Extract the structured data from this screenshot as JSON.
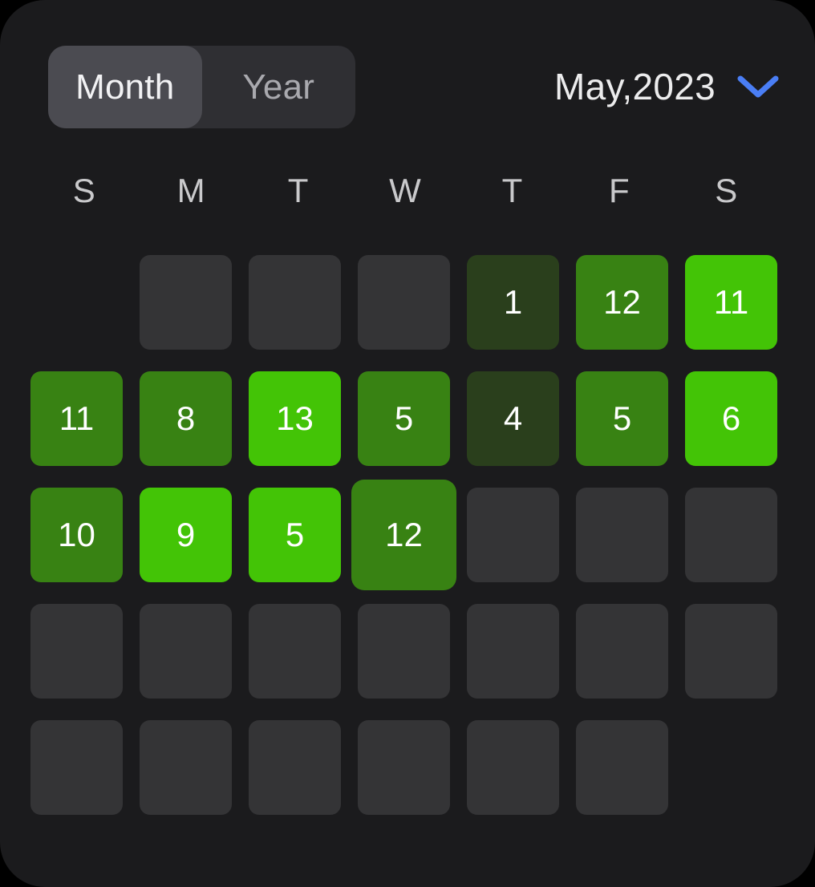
{
  "card": {
    "background_color": "#1b1b1d",
    "page_background_color": "#000000"
  },
  "header": {
    "segmented_control": {
      "name": "view-mode",
      "selected": "Month",
      "options": [
        {
          "label": "Month",
          "selected": true
        },
        {
          "label": "Year",
          "selected": false
        }
      ]
    },
    "month_selector": {
      "label": "May,2023",
      "month": "May",
      "year": "2023",
      "chevron_icon": "chevron-down-icon",
      "chevron_color": "#4a7ef5"
    }
  },
  "weekdays": [
    "S",
    "M",
    "T",
    "W",
    "T",
    "F",
    "S"
  ],
  "legend_colors": {
    "empty": "#343436",
    "level_1_low": "#2a3f1c",
    "level_2_mid": "#388213",
    "level_3_high": "#43c406",
    "day_text": "#ffffff"
  },
  "grid": {
    "columns": 7,
    "rows": 5,
    "cells": [
      {
        "value": "",
        "state": "blank",
        "level": 0,
        "selected": false
      },
      {
        "value": "",
        "state": "empty",
        "level": 0,
        "selected": false
      },
      {
        "value": "",
        "state": "empty",
        "level": 0,
        "selected": false
      },
      {
        "value": "",
        "state": "empty",
        "level": 0,
        "selected": false
      },
      {
        "value": "1",
        "state": "filled",
        "level": 1,
        "selected": false
      },
      {
        "value": "12",
        "state": "filled",
        "level": 2,
        "selected": false
      },
      {
        "value": "11",
        "state": "filled",
        "level": 3,
        "selected": false
      },
      {
        "value": "11",
        "state": "filled",
        "level": 2,
        "selected": false
      },
      {
        "value": "8",
        "state": "filled",
        "level": 2,
        "selected": false
      },
      {
        "value": "13",
        "state": "filled",
        "level": 3,
        "selected": false
      },
      {
        "value": "5",
        "state": "filled",
        "level": 2,
        "selected": false
      },
      {
        "value": "4",
        "state": "filled",
        "level": 1,
        "selected": false
      },
      {
        "value": "5",
        "state": "filled",
        "level": 2,
        "selected": false
      },
      {
        "value": "6",
        "state": "filled",
        "level": 3,
        "selected": false
      },
      {
        "value": "10",
        "state": "filled",
        "level": 2,
        "selected": false
      },
      {
        "value": "9",
        "state": "filled",
        "level": 3,
        "selected": false
      },
      {
        "value": "5",
        "state": "filled",
        "level": 3,
        "selected": false
      },
      {
        "value": "12",
        "state": "filled",
        "level": 2,
        "selected": true
      },
      {
        "value": "",
        "state": "empty",
        "level": 0,
        "selected": false
      },
      {
        "value": "",
        "state": "empty",
        "level": 0,
        "selected": false
      },
      {
        "value": "",
        "state": "empty",
        "level": 0,
        "selected": false
      },
      {
        "value": "",
        "state": "empty",
        "level": 0,
        "selected": false
      },
      {
        "value": "",
        "state": "empty",
        "level": 0,
        "selected": false
      },
      {
        "value": "",
        "state": "empty",
        "level": 0,
        "selected": false
      },
      {
        "value": "",
        "state": "empty",
        "level": 0,
        "selected": false
      },
      {
        "value": "",
        "state": "empty",
        "level": 0,
        "selected": false
      },
      {
        "value": "",
        "state": "empty",
        "level": 0,
        "selected": false
      },
      {
        "value": "",
        "state": "empty",
        "level": 0,
        "selected": false
      },
      {
        "value": "",
        "state": "empty",
        "level": 0,
        "selected": false
      },
      {
        "value": "",
        "state": "empty",
        "level": 0,
        "selected": false
      },
      {
        "value": "",
        "state": "empty",
        "level": 0,
        "selected": false
      },
      {
        "value": "",
        "state": "empty",
        "level": 0,
        "selected": false
      },
      {
        "value": "",
        "state": "empty",
        "level": 0,
        "selected": false
      },
      {
        "value": "",
        "state": "empty",
        "level": 0,
        "selected": false
      },
      {
        "value": "",
        "state": "blank",
        "level": 0,
        "selected": false
      }
    ]
  }
}
